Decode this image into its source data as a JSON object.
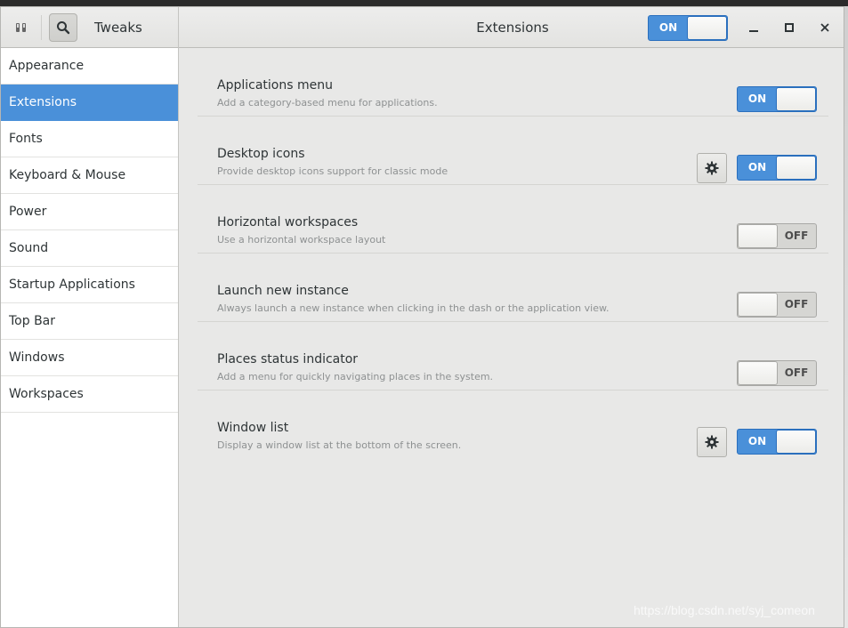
{
  "header": {
    "app_title": "Tweaks",
    "window_title": "Extensions",
    "global_switch": "ON",
    "icons": [
      "app-icon",
      "search-icon",
      "minimize-icon",
      "maximize-icon",
      "close-icon"
    ]
  },
  "sidebar": {
    "items": [
      {
        "label": "Appearance"
      },
      {
        "label": "Extensions"
      },
      {
        "label": "Fonts"
      },
      {
        "label": "Keyboard & Mouse"
      },
      {
        "label": "Power"
      },
      {
        "label": "Sound"
      },
      {
        "label": "Startup Applications"
      },
      {
        "label": "Top Bar"
      },
      {
        "label": "Windows"
      },
      {
        "label": "Workspaces"
      }
    ],
    "active": "Extensions"
  },
  "extensions": [
    {
      "name": "Applications menu",
      "description": "Add a category-based menu for applications.",
      "state": "ON",
      "has_settings": false
    },
    {
      "name": "Desktop icons",
      "description": "Provide desktop icons support for classic mode",
      "state": "ON",
      "has_settings": true
    },
    {
      "name": "Horizontal workspaces",
      "description": "Use a horizontal workspace layout",
      "state": "OFF",
      "has_settings": false
    },
    {
      "name": "Launch new instance",
      "description": "Always launch a new instance when clicking in the dash or the application view.",
      "state": "OFF",
      "has_settings": false
    },
    {
      "name": "Places status indicator",
      "description": "Add a menu for quickly navigating places in the system.",
      "state": "OFF",
      "has_settings": false
    },
    {
      "name": "Window list",
      "description": "Display a window list at the bottom of the screen.",
      "state": "ON",
      "has_settings": true
    }
  ],
  "colors": {
    "accent": "#4a90d9",
    "window_bg": "#e8e8e7",
    "sidebar_bg": "#ffffff"
  },
  "watermark": "https://blog.csdn.net/syj_comeon"
}
